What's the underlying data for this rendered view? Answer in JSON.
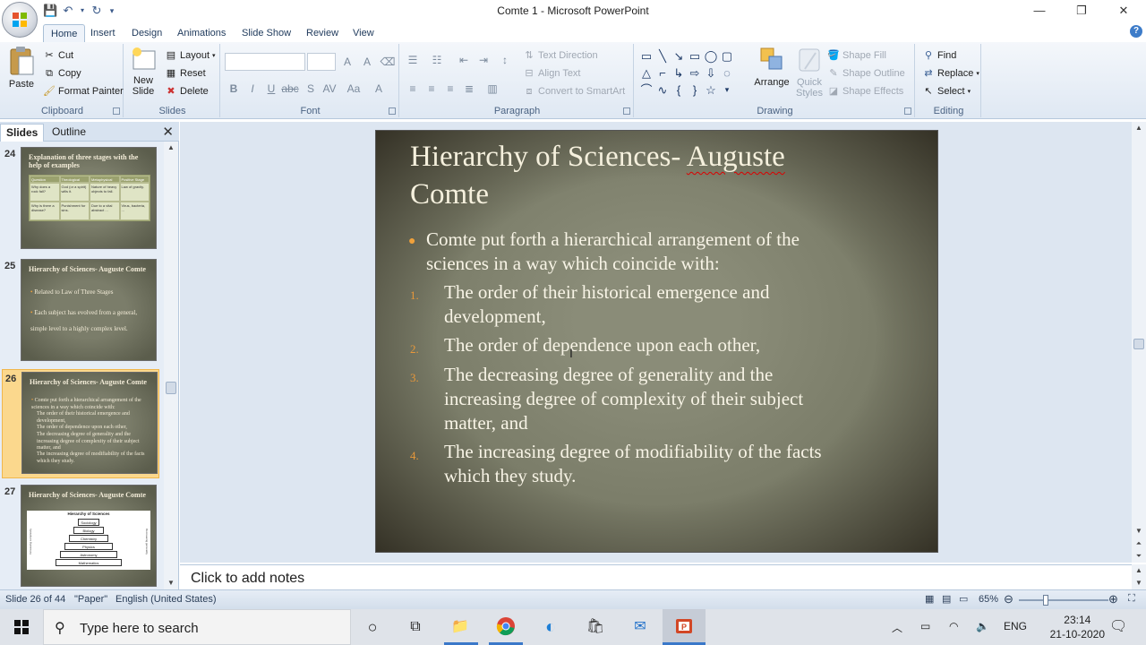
{
  "window": {
    "title": "Comte 1 - Microsoft PowerPoint",
    "minimize": "—",
    "restore": "❐",
    "close": "✕"
  },
  "ribbon_tabs": [
    "Home",
    "Insert",
    "Design",
    "Animations",
    "Slide Show",
    "Review",
    "View"
  ],
  "ribbon": {
    "clipboard": {
      "label": "Clipboard",
      "paste": "Paste",
      "cut": "Cut",
      "copy": "Copy",
      "format_painter": "Format Painter"
    },
    "slides": {
      "label": "Slides",
      "new_slide": "New Slide",
      "new_slide_line1": "New",
      "new_slide_line2": "Slide",
      "layout": "Layout",
      "reset": "Reset",
      "delete": "Delete"
    },
    "font": {
      "label": "Font"
    },
    "paragraph": {
      "label": "Paragraph",
      "text_direction": "Text Direction",
      "align_text": "Align Text",
      "convert_smartart": "Convert to SmartArt"
    },
    "drawing": {
      "label": "Drawing",
      "arrange": "Arrange",
      "quick_styles_line1": "Quick",
      "quick_styles_line2": "Styles",
      "shape_fill": "Shape Fill",
      "shape_outline": "Shape Outline",
      "shape_effects": "Shape Effects"
    },
    "editing": {
      "label": "Editing",
      "find": "Find",
      "replace": "Replace",
      "select": "Select"
    }
  },
  "panel": {
    "tab_slides": "Slides",
    "tab_outline": "Outline",
    "thumbnails": [
      {
        "number": "24",
        "title": "Explanation of three stages with the help of examples",
        "table": {
          "headers": [
            "Question",
            "Theological Stage",
            "Metaphysical Stage",
            "Positive Stage"
          ],
          "rows": [
            [
              "Why does a rock fall?",
              "God (or a spirit) wills it.",
              "Nature of heavy objects to fall.",
              "Law of gravity."
            ],
            [
              "Why is there a disease?",
              "Punishment for sins.",
              "Due to a vital abstract ...",
              "Virus, bacteria, ..."
            ]
          ]
        }
      },
      {
        "number": "25",
        "title": "Hierarchy of Sciences- Auguste Comte",
        "body": [
          "Related to Law of Three Stages",
          "Each subject has evolved from a general, simple level to a highly complex level."
        ]
      },
      {
        "number": "26",
        "title": "Hierarchy of Sciences- Auguste Comte",
        "body": [
          "Comte put forth a hierarchical arrangement of the sciences in a way which coincide with:",
          "The order of their historical emergence and development,",
          "The order of dependence upon each other,",
          "The decreasing degree of generality and the increasing degree of complexity of their subject matter, and",
          "The increasing degree of modifiability of the facts which they study."
        ]
      },
      {
        "number": "27",
        "title": "Hierarchy of Sciences- Auguste Comte",
        "pyramid_title": "Hierarchy of Sciences",
        "pyramid": [
          "Sociology",
          "Biology",
          "Chemistry",
          "Physics",
          "Astronomy",
          "Mathematics"
        ],
        "left_arrow": "Increasing complexity",
        "right_arrow": "Decreasing generality"
      }
    ]
  },
  "slide": {
    "title_part1": "Hierarchy of Sciences- ",
    "title_part2": "Auguste",
    "title_line2": "Comte",
    "bullet_line1": "Comte put forth a hierarchical arrangement of the",
    "bullet_line2": "sciences in a way which coincide with:",
    "items": [
      {
        "num": "1.",
        "lines": [
          "The order of their historical emergence and",
          "development,"
        ]
      },
      {
        "num": "2.",
        "lines": [
          "The order of dependence upon each other,"
        ]
      },
      {
        "num": "3.",
        "lines": [
          "The decreasing degree of generality and the",
          "increasing degree of complexity of their subject",
          "matter, and"
        ]
      },
      {
        "num": "4.",
        "lines": [
          "The increasing degree of modifiability of the facts",
          "which they study."
        ]
      }
    ]
  },
  "notes_placeholder": "Click to add notes",
  "status": {
    "slide_info": "Slide 26 of 44",
    "theme": "\"Paper\"",
    "language": "English (United States)",
    "zoom": "65%"
  },
  "taskbar": {
    "search_placeholder": "Type here to search",
    "language": "ENG",
    "time": "23:14",
    "date": "21-10-2020"
  }
}
